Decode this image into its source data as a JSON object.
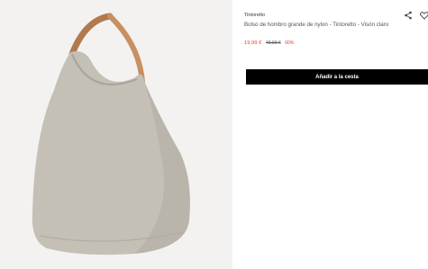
{
  "product": {
    "brand": "Tintoretto",
    "title": "Bolso de hombro grande de nylon - Tintoretto - Visón claro",
    "price": "19,99 €",
    "old_price": "49,99 €",
    "discount": "60%"
  },
  "actions": {
    "add_to_cart": "Añadir a la cesta"
  },
  "icons": {
    "share": "share-icon",
    "wishlist": "heart-icon"
  },
  "colors": {
    "price": "#e0402a",
    "button": "#000000",
    "bag": "#c4c0b6",
    "strap": "#b07a4c"
  }
}
